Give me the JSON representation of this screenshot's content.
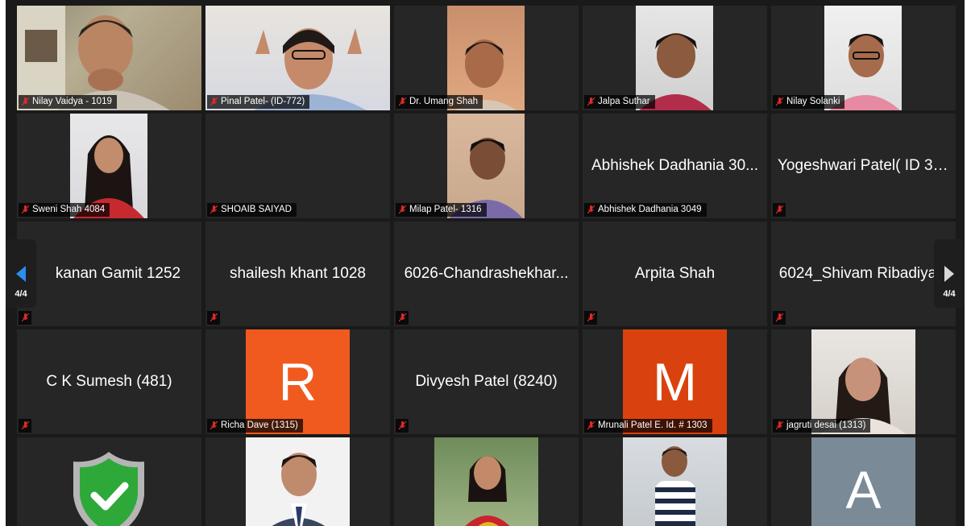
{
  "meeting": {
    "page_indicator_left": "4/4",
    "page_indicator_right": "4/4",
    "participants": [
      {
        "label": "Nilay Vaidya - 1019"
      },
      {
        "label": "Pinal Patel- (ID-772)"
      },
      {
        "label": "Dr. Umang Shah"
      },
      {
        "label": "Jalpa Suthar"
      },
      {
        "label": "Nilay Solanki"
      },
      {
        "label": "Sweni Shah 4084"
      },
      {
        "label": "SHOAIB SAIYAD"
      },
      {
        "label": "Milap Patel- 1316"
      },
      {
        "label": "Abhishek Dadhania 3049",
        "display": "Abhishek Dadhania 30..."
      },
      {
        "label": "",
        "display": "Yogeshwari Patel( ID 31..."
      },
      {
        "label": "",
        "display": "kanan Gamit 1252"
      },
      {
        "label": "",
        "display": "shailesh khant 1028"
      },
      {
        "label": "",
        "display": "6026-Chandrashekhar..."
      },
      {
        "label": "",
        "display": "Arpita Shah"
      },
      {
        "label": "",
        "display": "6024_Shivam Ribadiya"
      },
      {
        "label": "",
        "display": "C K Sumesh (481)"
      },
      {
        "label": "Richa Dave (1315)",
        "avatar_letter": "R",
        "avatar_color": "#f05a1e"
      },
      {
        "label": "",
        "display": "Divyesh Patel (8240)"
      },
      {
        "label": "Mrunali Patel E. Id. # 1303",
        "avatar_letter": "M",
        "avatar_color": "#d9420e"
      },
      {
        "label": "jagruti desai (1313)"
      },
      {
        "icon": "shield-check-icon"
      },
      {
        "label": ""
      },
      {
        "label": ""
      },
      {
        "label": ""
      },
      {
        "label": "",
        "avatar_letter": "A",
        "avatar_color": "#7a8a96"
      }
    ]
  },
  "colors": {
    "muted_mic": "#e02a2a",
    "tile_bg": "#262626",
    "frame_bg": "#1a1a1a",
    "nav_arrow": "#2d8cf0"
  }
}
